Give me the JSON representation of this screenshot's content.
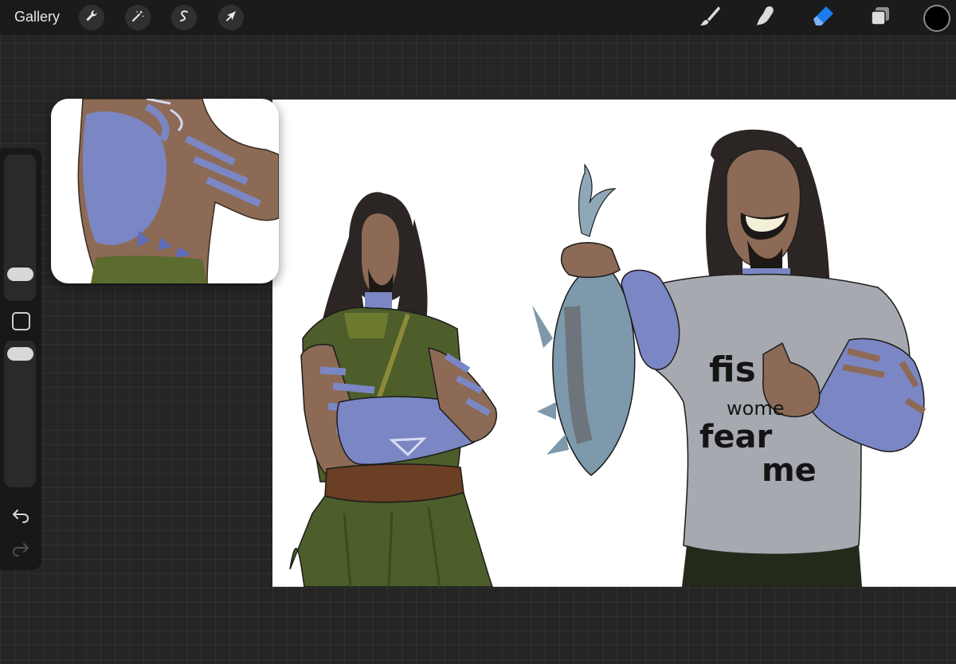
{
  "app": {
    "gallery_label": "Gallery"
  },
  "toolbar": {
    "actions": [
      {
        "name": "actions",
        "icon": "wrench-icon"
      },
      {
        "name": "adjustments",
        "icon": "magic-wand-icon"
      },
      {
        "name": "selection",
        "icon": "selection-s-icon"
      },
      {
        "name": "transform",
        "icon": "arrow-cursor-icon"
      }
    ],
    "tools": [
      {
        "name": "brush",
        "icon": "brush-icon",
        "active": false
      },
      {
        "name": "smudge",
        "icon": "smudge-finger-icon",
        "active": false
      },
      {
        "name": "eraser",
        "icon": "eraser-icon",
        "active": true
      },
      {
        "name": "layers",
        "icon": "layers-icon",
        "active": false
      }
    ],
    "current_color": "#000000",
    "active_color": "#1a7cf0"
  },
  "sidebar": {
    "brush_size_level": 0.15,
    "opacity_level": 0.95,
    "icons": [
      "modify-square-icon",
      "undo-icon",
      "redo-icon"
    ]
  },
  "canvas": {
    "shirt_text": {
      "line1": "fis",
      "line2": "wome",
      "line3": "fear",
      "line4": "me"
    }
  },
  "colors": {
    "skin": "#8c6a55",
    "tattoo": "#7b87c4",
    "tunic": "#4d5e2a",
    "belt": "#6b3f24",
    "shirt": "#a7a9b0",
    "fish": "#7d99ab",
    "hair": "#2b2623"
  }
}
